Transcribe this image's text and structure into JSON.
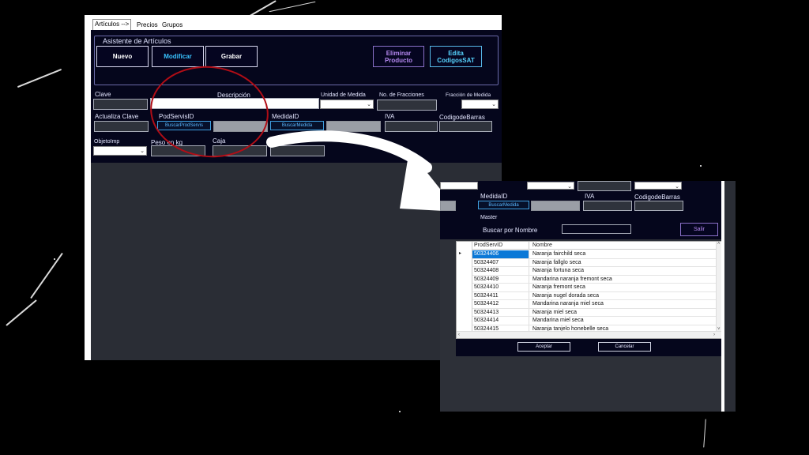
{
  "main_window": {
    "tabs": [
      "Artículos -->",
      "Precios",
      "Grupos"
    ],
    "group_title": "Asistente de Artículos",
    "buttons": {
      "nuevo": "Nuevo",
      "modificar": "Modificar",
      "grabar": "Grabar",
      "eliminar": "Eliminar Producto",
      "edita": "Edita CodigosSAT"
    },
    "labels": {
      "clave": "Clave",
      "descripcion": "Descripción",
      "unidad": "Unidad de Medida",
      "fracciones": "No. de Fracciones",
      "fraccion_medida": "Fracción de Medida",
      "actualiza_clave": "Actualiza Clave",
      "prodservis": "PodServisID",
      "medida": "MedidaID",
      "iva": "IVA",
      "codigo_barras": "CodigodeBarras",
      "objeto_imp": "ObjetoImp",
      "peso": "Peso en kg",
      "caja": "Caja",
      "master": "Master"
    },
    "link_buttons": {
      "buscar_prod": "BuscarProdServis",
      "buscar_medida": "BuscarMedida"
    }
  },
  "zoom_window": {
    "labels": {
      "medida": "MedidaID",
      "iva": "IVA",
      "codigo_barras": "CodigodeBarras",
      "master": "Master",
      "buscar_nombre": "Buscar por Nombre"
    },
    "buscar_medida": "BuscarMedida",
    "salir": "Salir",
    "grid": {
      "columns": [
        "ProdServID",
        "Nombre"
      ],
      "rows": [
        {
          "id": "50324406",
          "name": "Naranja fairchild seca"
        },
        {
          "id": "50324407",
          "name": "Naranja fallglo seca"
        },
        {
          "id": "50324408",
          "name": "Naranja fortuna seca"
        },
        {
          "id": "50324409",
          "name": "Mandarina naranja fremont seca"
        },
        {
          "id": "50324410",
          "name": "Naranja fremont seca"
        },
        {
          "id": "50324411",
          "name": "Naranja nugel dorada seca"
        },
        {
          "id": "50324412",
          "name": "Mandarina naranja miel seca"
        },
        {
          "id": "50324413",
          "name": "Naranja miel seca"
        },
        {
          "id": "50324414",
          "name": "Mandarina miel seca"
        },
        {
          "id": "50324415",
          "name": "Naranja tanjelo honebelle seca"
        }
      ]
    },
    "aceptar": "Aceptar",
    "cancelar": "Cancelar"
  },
  "colors": {
    "form_bg": "#05061c",
    "red_oval": "#b00d16",
    "selection": "#0a78d7"
  }
}
